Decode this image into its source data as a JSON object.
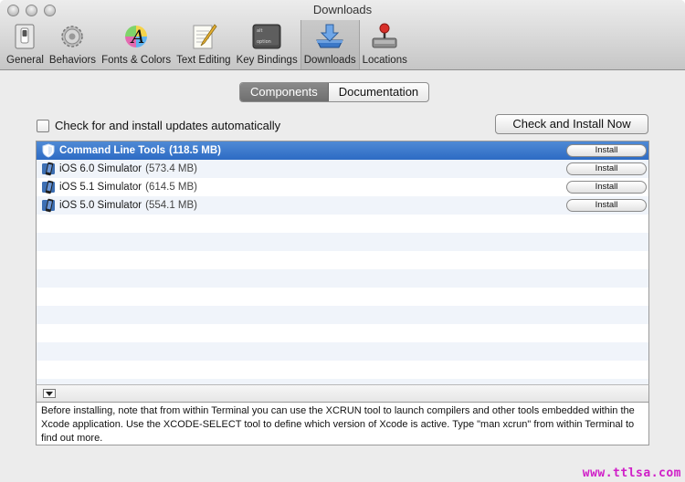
{
  "window": {
    "title": "Downloads"
  },
  "toolbar": {
    "items": [
      {
        "label": "General",
        "icon": "switch-icon",
        "selected": false
      },
      {
        "label": "Behaviors",
        "icon": "gears-icon",
        "selected": false
      },
      {
        "label": "Fonts & Colors",
        "icon": "fonts-colors-icon",
        "selected": false
      },
      {
        "label": "Text Editing",
        "icon": "text-editing-icon",
        "selected": false
      },
      {
        "label": "Key Bindings",
        "icon": "keyboard-key-icon",
        "selected": false
      },
      {
        "label": "Downloads",
        "icon": "download-tray-icon",
        "selected": true
      },
      {
        "label": "Locations",
        "icon": "joystick-drive-icon",
        "selected": false
      }
    ],
    "key_bindings_keys": [
      "alt",
      "option"
    ]
  },
  "tabs": [
    {
      "label": "Components",
      "active": true
    },
    {
      "label": "Documentation",
      "active": false
    }
  ],
  "auto_update": {
    "label": "Check for and install updates automatically",
    "checked": false
  },
  "check_install_button": "Check and Install Now",
  "components": [
    {
      "name": "Command Line Tools",
      "size": "(118.5 MB)",
      "action": "Install",
      "icon": "command-line-tools-icon",
      "selected": true
    },
    {
      "name": "iOS 6.0 Simulator",
      "size": "(573.4 MB)",
      "action": "Install",
      "icon": "ios-simulator-icon",
      "selected": false
    },
    {
      "name": "iOS 5.1 Simulator",
      "size": "(614.5 MB)",
      "action": "Install",
      "icon": "ios-simulator-icon",
      "selected": false
    },
    {
      "name": "iOS 5.0 Simulator",
      "size": "(554.1 MB)",
      "action": "Install",
      "icon": "ios-simulator-icon",
      "selected": false
    }
  ],
  "description": "Before installing, note that from within Terminal you can use the XCRUN tool to launch compilers and other tools embedded within the Xcode application. Use the XCODE-SELECT tool to define which version of Xcode is active.  Type \"man xcrun\" from within Terminal to find out more.",
  "watermark": "www.ttlsa.com",
  "colors": {
    "selection": "#2d6bc4",
    "watermark": "#d020c8"
  }
}
